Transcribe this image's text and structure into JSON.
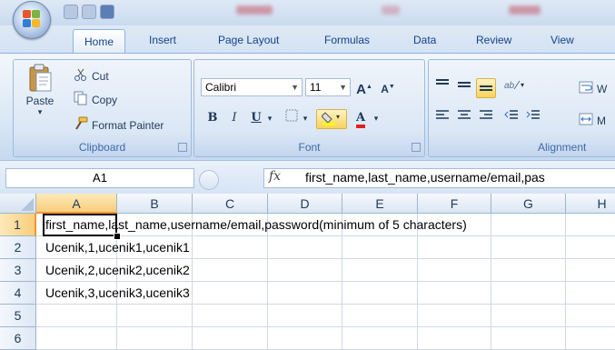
{
  "ribbon_tabs": [
    "Home",
    "Insert",
    "Page Layout",
    "Formulas",
    "Data",
    "Review",
    "View"
  ],
  "clipboard": {
    "paste_label": "Paste",
    "cut_label": "Cut",
    "copy_label": "Copy",
    "format_painter_label": "Format Painter",
    "group_label": "Clipboard"
  },
  "font": {
    "name": "Calibri",
    "size": "11",
    "group_label": "Font",
    "bold": "B",
    "italic": "I",
    "underline": "U",
    "grow": "A",
    "shrink": "A",
    "color": "A"
  },
  "alignment": {
    "group_label": "Alignment",
    "wrap_label": "W",
    "merge_label": "M"
  },
  "formula_bar": {
    "name_box": "A1",
    "fx": "fx",
    "content": "first_name,last_name,username/email,pas"
  },
  "sheet": {
    "columns": [
      "A",
      "B",
      "C",
      "D",
      "E",
      "F",
      "G",
      "H"
    ],
    "rows": [
      "1",
      "2",
      "3",
      "4",
      "5",
      "6"
    ],
    "row_text": [
      "first_name,last_name,username/email,password(minimum of 5 characters)",
      "Ucenik,1,ucenik1,ucenik1",
      "Ucenik,2,ucenik2,ucenik2",
      "Ucenik,3,ucenik3,ucenik3",
      "",
      ""
    ]
  },
  "colors": {
    "accent": "#15428b",
    "selected_header": "#f8ce7b",
    "ribbon": "#dce8f6"
  },
  "icons": [
    "office-button-icon",
    "save-icon",
    "undo-icon",
    "redo-icon",
    "paste-icon",
    "cut-icon",
    "copy-icon",
    "format-painter-icon",
    "fill-color-icon",
    "wrap-text-icon",
    "merge-icon"
  ]
}
